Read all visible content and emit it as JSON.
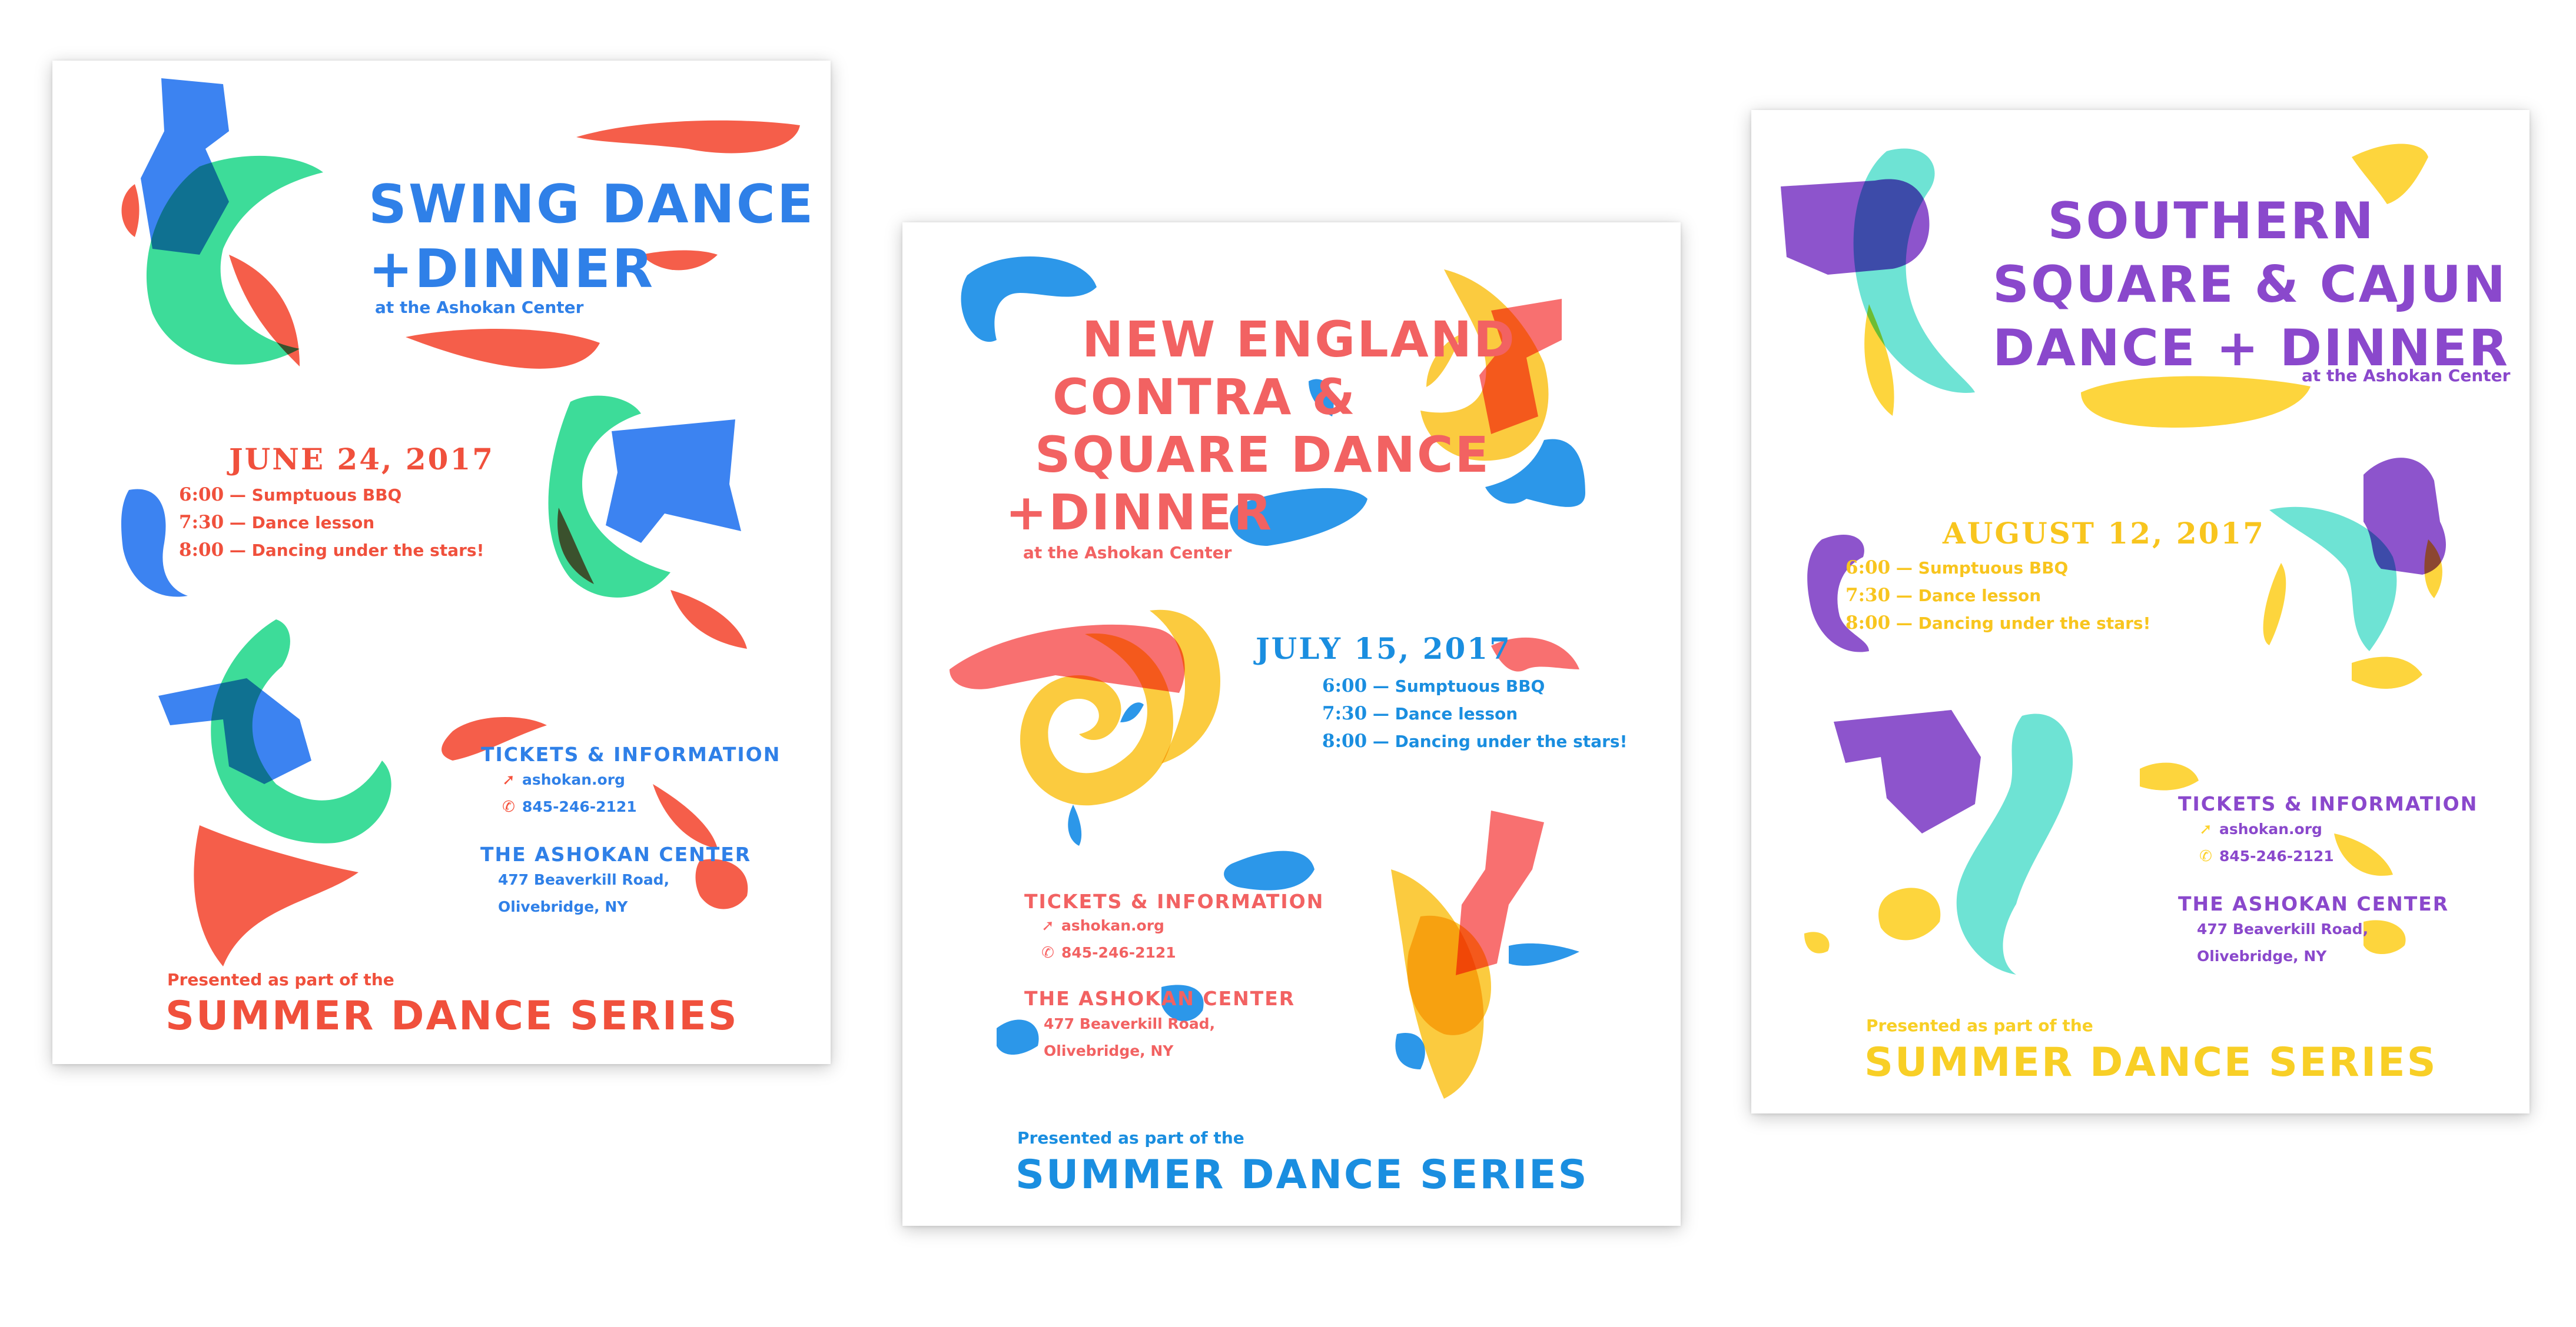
{
  "posters": [
    {
      "title_lines": [
        "SWING DANCE",
        "+DINNER"
      ],
      "venue_small": "at the Ashokan Center",
      "date": "JUNE 24, 2017",
      "schedule": [
        {
          "time": "6:00",
          "sep": "—",
          "text": "Sumptuous BBQ"
        },
        {
          "time": "7:30",
          "sep": "—",
          "text": "Dance lesson"
        },
        {
          "time": "8:00",
          "sep": "—",
          "text": "Dancing under the stars!"
        }
      ],
      "tickets_heading": "TICKETS & INFORMATION",
      "website": "ashokan.org",
      "phone": "845-246-2121",
      "center_heading": "THE ASHOKAN CENTER",
      "address_lines": [
        "477 Beaverkill Road,",
        "Olivebridge, NY"
      ],
      "presented": "Presented as part of the",
      "series": "SUMMER DANCE SERIES",
      "colors": {
        "title": "#2f80e8",
        "date": "#f0503c",
        "info": "#2f80e8",
        "series": "#f0503c",
        "shape_a": "#2b78f0",
        "shape_b": "#28d88e",
        "shape_c": "#f5503a"
      }
    },
    {
      "title_lines": [
        "NEW ENGLAND",
        "CONTRA &",
        "SQUARE DANCE",
        "+DINNER"
      ],
      "venue_small": "at the Ashokan Center",
      "date": "JULY 15, 2017",
      "schedule": [
        {
          "time": "6:00",
          "sep": "—",
          "text": "Sumptuous BBQ"
        },
        {
          "time": "7:30",
          "sep": "—",
          "text": "Dance lesson"
        },
        {
          "time": "8:00",
          "sep": "—",
          "text": "Dancing under the stars!"
        }
      ],
      "tickets_heading": "TICKETS & INFORMATION",
      "website": "ashokan.org",
      "phone": "845-246-2121",
      "center_heading": "THE ASHOKAN CENTER",
      "address_lines": [
        "477 Beaverkill Road,",
        "Olivebridge, NY"
      ],
      "presented": "Presented as part of the",
      "series": "SUMMER DANCE SERIES",
      "colors": {
        "title": "#f26262",
        "date": "#1a8ee0",
        "info": "#f26262",
        "series": "#1a8ee0",
        "shape_a": "#1a8ee8",
        "shape_b": "#fbc62a",
        "shape_c": "#f86464"
      }
    },
    {
      "title_lines": [
        "SOUTHERN",
        "SQUARE & CAJUN",
        "DANCE + DINNER"
      ],
      "venue_small": "at the Ashokan Center",
      "date": "AUGUST 12, 2017",
      "schedule": [
        {
          "time": "6:00",
          "sep": "—",
          "text": "Sumptuous BBQ"
        },
        {
          "time": "7:30",
          "sep": "—",
          "text": "Dance lesson"
        },
        {
          "time": "8:00",
          "sep": "—",
          "text": "Dancing under the stars!"
        }
      ],
      "tickets_heading": "TICKETS & INFORMATION",
      "website": "ashokan.org",
      "phone": "845-246-2121",
      "center_heading": "THE ASHOKAN CENTER",
      "address_lines": [
        "477 Beaverkill Road,",
        "Olivebridge, NY"
      ],
      "presented": "Presented as part of the",
      "series": "SUMMER DANCE SERIES",
      "colors": {
        "title": "#8a48cc",
        "date": "#f8c51e",
        "info": "#8a48cc",
        "series": "#f8cf26",
        "shape_a": "#8345c8",
        "shape_b": "#5ee0d0",
        "shape_c": "#fdd22c"
      }
    }
  ],
  "icons": {
    "website": "cursor-click-icon",
    "phone": "phone-icon"
  }
}
